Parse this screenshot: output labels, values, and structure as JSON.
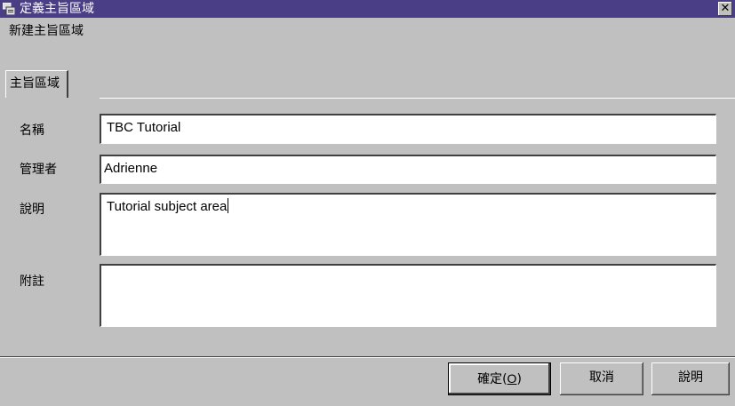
{
  "window": {
    "title": "定義主旨區域",
    "close_label": "✕"
  },
  "header": {
    "subtitle": "新建主旨區域"
  },
  "tabs": [
    {
      "label": "主旨區域",
      "selected": true
    }
  ],
  "form": {
    "name_label": "名稱",
    "name_value": "TBC Tutorial",
    "owner_label": "管理者",
    "owner_value": "Adrienne",
    "description_label": "說明",
    "description_value": "Tutorial subject area",
    "notes_label": "附註",
    "notes_value": ""
  },
  "buttons": {
    "ok_label": "確定",
    "ok_mnemonic_prefix": "(",
    "ok_mnemonic": "O",
    "ok_mnemonic_suffix": ")",
    "cancel_label": "取消",
    "help_label": "說明"
  },
  "colors": {
    "titlebar": "#4a3e86",
    "background": "#c0c0c0"
  }
}
